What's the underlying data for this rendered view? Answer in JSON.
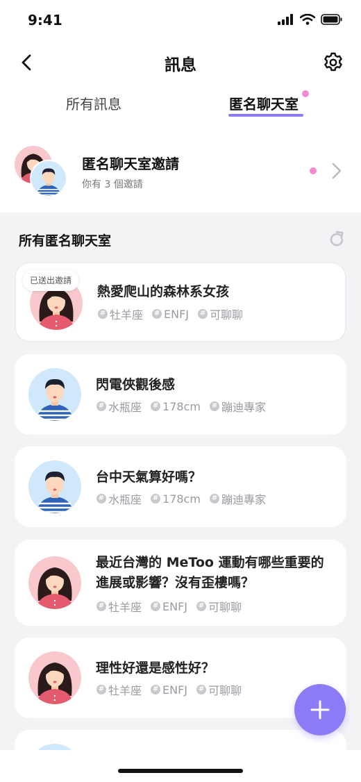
{
  "status_bar": {
    "time": "9:41"
  },
  "nav": {
    "title": "訊息"
  },
  "tabs": [
    {
      "label": "所有訊息",
      "active": false
    },
    {
      "label": "匿名聊天室",
      "active": true,
      "has_dot": true
    }
  ],
  "invite_banner": {
    "title": "匿名聊天室邀請",
    "subtitle": "你有 3 個邀請",
    "has_dot": true
  },
  "section": {
    "title": "所有匿名聊天室"
  },
  "rooms": [
    {
      "title": "熱愛爬山的森林系女孩",
      "avatar": "female",
      "badge": "已送出邀請",
      "tags": [
        "牡羊座",
        "ENFJ",
        "可聊聊"
      ]
    },
    {
      "title": "閃電俠觀後感",
      "avatar": "male",
      "tags": [
        "水瓶座",
        "178cm",
        "蹦迪專家"
      ]
    },
    {
      "title": "台中天氣算好嗎？",
      "avatar": "male",
      "tags": [
        "水瓶座",
        "178cm",
        "蹦迪專家"
      ]
    },
    {
      "title": "最近台灣的 MeToo 運動有哪些重要的進展或影響？沒有歪樓嗎？",
      "avatar": "female",
      "tags": [
        "牡羊座",
        "ENFJ",
        "可聊聊"
      ]
    },
    {
      "title": "理性好還是感性好？",
      "avatar": "female",
      "tags": [
        "牡羊座",
        "ENFJ",
        "可聊聊"
      ]
    }
  ],
  "colors": {
    "accent": "#8b7cf6",
    "dot": "#f08bd0",
    "list_bg": "#f3f3f5"
  },
  "icons": [
    "signal-icon",
    "wifi-icon",
    "battery-icon",
    "back-icon",
    "gear-icon",
    "chevron-right-icon",
    "refresh-icon",
    "hashtag-icon",
    "plus-icon"
  ]
}
